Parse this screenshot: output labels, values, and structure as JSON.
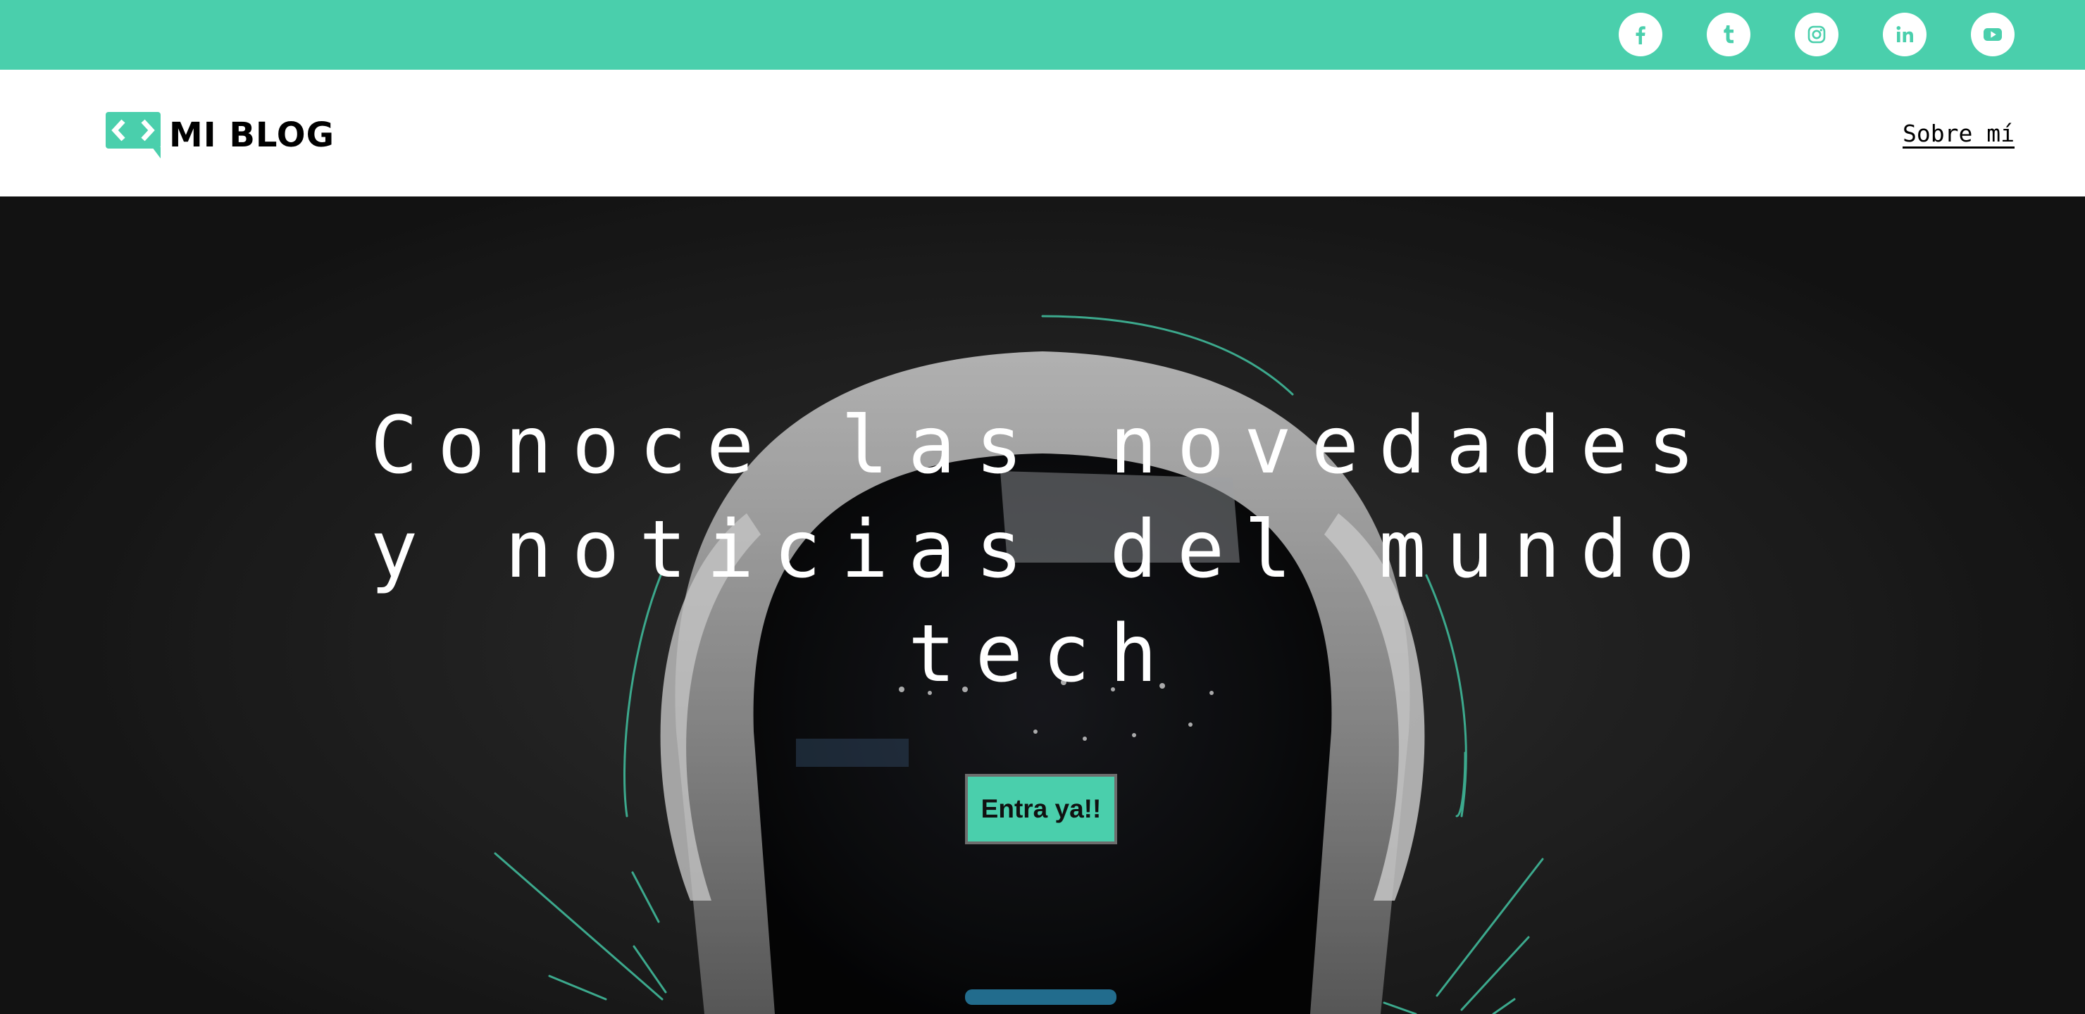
{
  "colors": {
    "accent": "#4acfac",
    "hero_bg": "#2a2a2a",
    "text_light": "#ffffff",
    "text_dark": "#000000"
  },
  "social": [
    {
      "name": "facebook",
      "icon": "facebook-icon"
    },
    {
      "name": "tumblr",
      "icon": "tumblr-icon"
    },
    {
      "name": "instagram",
      "icon": "instagram-icon"
    },
    {
      "name": "linkedin",
      "icon": "linkedin-icon"
    },
    {
      "name": "youtube",
      "icon": "youtube-icon"
    }
  ],
  "header": {
    "logo_text": "MI BLOG",
    "logo_icon": "code-bubble-icon",
    "nav": {
      "about": "Sobre mí"
    }
  },
  "hero": {
    "title": "Conoce las novedades y noticias del mundo tech",
    "cta_label": "Entra ya!!"
  }
}
